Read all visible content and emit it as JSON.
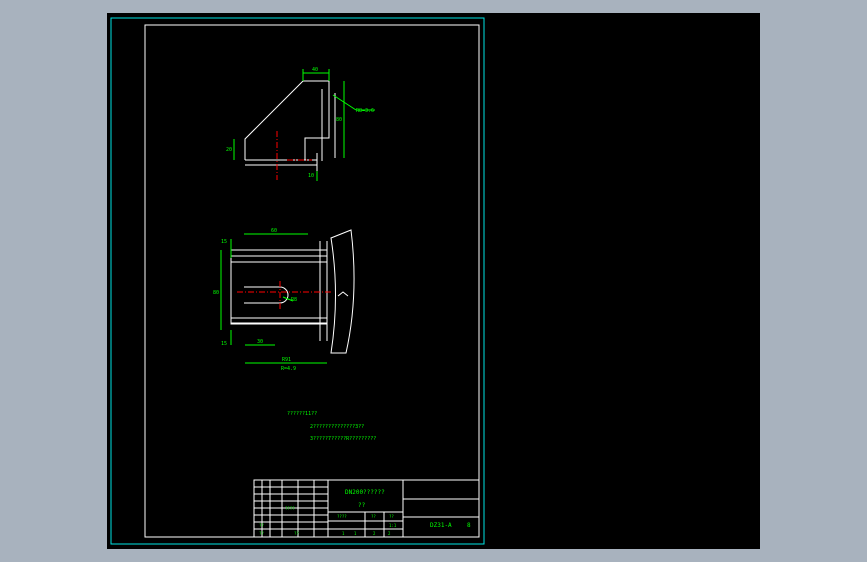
{
  "colors": {
    "background": "#a8b2be",
    "canvas": "#000000",
    "frame": "#00e5e5",
    "outline": "#ffffff",
    "dimension": "#00ff00",
    "centerline": "#ff0000"
  },
  "front_view": {
    "dims": {
      "top": "40",
      "right": "80",
      "left": "20",
      "bottom": "10",
      "callout": "R8=3.6"
    }
  },
  "plan_view": {
    "dims": {
      "top_width": "60",
      "top_offset": "15",
      "overall_height": "80",
      "bottom_offset": "15",
      "slot_offset": "30",
      "overall_width": "R91",
      "slot_radius": "R8",
      "note": "R=4.9"
    }
  },
  "notes": [
    "??????11??",
    "2??????????????3??",
    "3?????7?????R?????????"
  ],
  "title_block": {
    "title_line1": "DN200??????",
    "title_line2": "??",
    "drawing_number": "DZ31-A",
    "sheet": "8",
    "left_cells": [
      "????",
      "??",
      "??",
      "??"
    ],
    "mid_cells": [
      "????",
      "??",
      "??",
      "1:1",
      "1",
      "1",
      "2",
      "2"
    ]
  }
}
